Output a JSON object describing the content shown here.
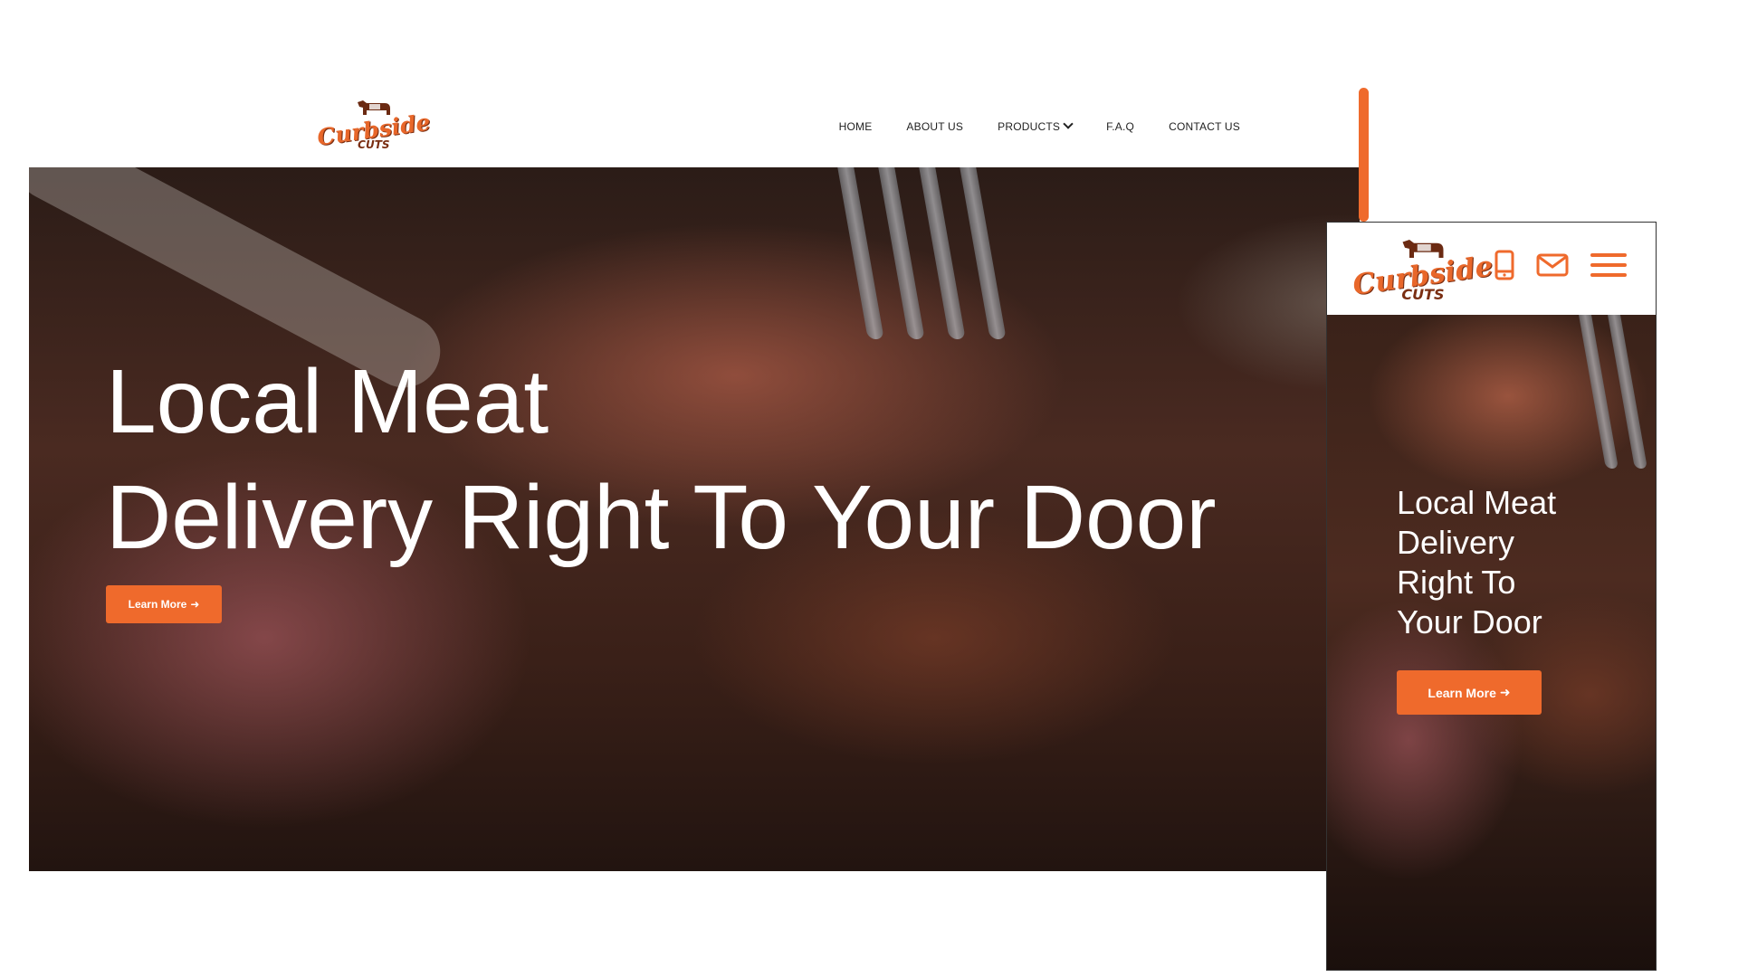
{
  "brand": {
    "script": "Curbside",
    "sub": "CUTS",
    "accent": "#ef6a2c",
    "dark": "#7a2e12"
  },
  "nav": {
    "items": [
      {
        "label": "HOME"
      },
      {
        "label": "ABOUT US"
      },
      {
        "label": "PRODUCTS",
        "has_dropdown": true
      },
      {
        "label": "F.A.Q"
      },
      {
        "label": "CONTACT US"
      }
    ]
  },
  "hero": {
    "line1": "Local Meat",
    "line2": "Delivery Right To Your Door",
    "button_label": "Learn More",
    "button_icon": "arrow-right-icon"
  },
  "mobile": {
    "icons": [
      "phone-icon",
      "mail-icon",
      "hamburger-menu-icon"
    ],
    "hero_lines": [
      "Local Meat",
      "Delivery",
      "Right To",
      "Your Door"
    ],
    "button_label": "Learn More"
  }
}
